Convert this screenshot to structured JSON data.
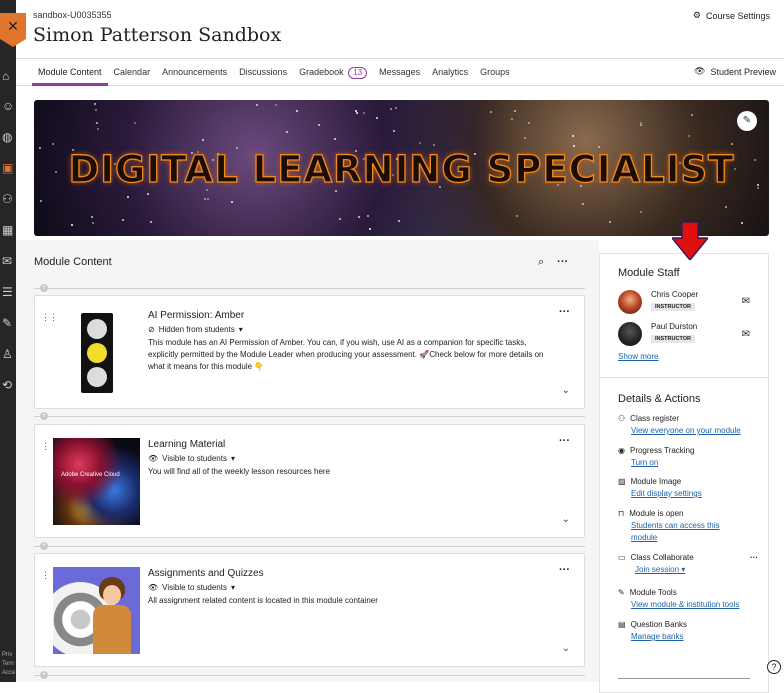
{
  "header": {
    "course_id": "sandbox-U0035355",
    "course_title": "Simon Patterson Sandbox",
    "settings_label": "Course Settings",
    "student_preview_label": "Student Preview"
  },
  "tabs": [
    {
      "label": "Module Content"
    },
    {
      "label": "Calendar"
    },
    {
      "label": "Announcements"
    },
    {
      "label": "Discussions"
    },
    {
      "label": "Gradebook",
      "badge": "13"
    },
    {
      "label": "Messages"
    },
    {
      "label": "Analytics"
    },
    {
      "label": "Groups"
    }
  ],
  "banner": {
    "text": "DIGITAL LEARNING SPECIALIST"
  },
  "module_content": {
    "title": "Module Content",
    "items": [
      {
        "title": "AI Permission: Amber",
        "visibility": "Hidden from students",
        "description": "This module has an AI Permission of Amber. You can, if you wish, use AI as a companion for specific tasks, explicitly permitted by the Module Leader when producing your assessment. 🚀Check below for more details on what it means for this module 👇"
      },
      {
        "title": "Learning Material",
        "visibility": "Visible to students",
        "description": "You will find all of the weekly lesson resources here",
        "thumb_text": "Adobe Creative Cloud"
      },
      {
        "title": "Assignments and Quizzes",
        "visibility": "Visible to students",
        "description": "All assignment related content is located in this module container"
      }
    ]
  },
  "staff": {
    "title": "Module Staff",
    "members": [
      {
        "name": "Chris Cooper",
        "role": "INSTRUCTOR"
      },
      {
        "name": "Paul Durston",
        "role": "INSTRUCTOR"
      }
    ],
    "show_more": "Show more"
  },
  "details": {
    "title": "Details & Actions",
    "actions": [
      {
        "label": "Class register",
        "link": "View everyone on your module",
        "icon": "people-icon"
      },
      {
        "label": "Progress Tracking",
        "link": "Turn on",
        "icon": "check-circle-icon"
      },
      {
        "label": "Module Image",
        "link": "Edit display settings",
        "icon": "image-icon"
      },
      {
        "label": "Module is open",
        "link": "Students can access this module",
        "icon": "unlock-icon"
      },
      {
        "label": "Class Collaborate",
        "link": "Join session",
        "icon": "video-icon"
      },
      {
        "label": "Module Tools",
        "link": "View module & institution tools",
        "icon": "wrench-icon"
      },
      {
        "label": "Question Banks",
        "link": "Manage banks",
        "icon": "bank-icon"
      }
    ]
  },
  "rail_footer": [
    "Priv",
    "Tern",
    "Acce"
  ],
  "colors": {
    "accent": "#8a3fa0",
    "orange": "#e0762b",
    "link": "#1c63a8",
    "arrow": "#e01010"
  }
}
